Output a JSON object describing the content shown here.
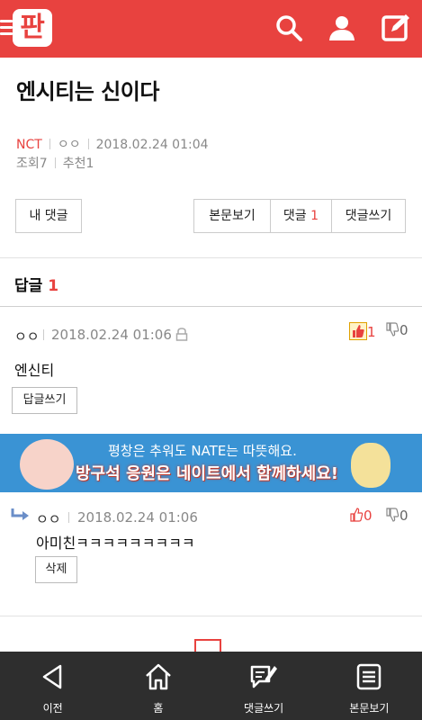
{
  "header": {
    "logo_text": "판",
    "icons": [
      "menu-icon",
      "search-icon",
      "user-icon",
      "write-icon"
    ],
    "bg_color": "#e8423f"
  },
  "post": {
    "title": "엔시티는 신이다",
    "category": "NCT",
    "author": "ㅇㅇ",
    "date": "2018.02.24 01:04",
    "views_label": "조회",
    "views": "7",
    "recommend_label": "추천",
    "recommends": "1"
  },
  "buttons": {
    "my_comments": "내 댓글",
    "view_body": "본문보기",
    "comments_label": "댓글",
    "comments_count": "1",
    "write_comment": "댓글쓰기"
  },
  "replies": {
    "heading_label": "답글",
    "count": "1"
  },
  "comments": [
    {
      "author": "ㅇㅇ",
      "date": "2018.02.24 01:06",
      "text": "엔신티",
      "action": "답글쓰기",
      "likes": "1",
      "dislikes": "0"
    },
    {
      "author": "ㅇㅇ",
      "date": "2018.02.24 01:06",
      "text": "아미친ㅋㅋㅋㅋㅋㅋㅋㅋㅋ",
      "action": "삭제",
      "likes": "0",
      "dislikes": "0"
    }
  ],
  "banner": {
    "line1": "평창은 추워도 NATE는 따뜻해요.",
    "line2": "방구석 응원은 네이트에서 함께하세요!"
  },
  "bottom_nav": [
    {
      "label": "이전",
      "icon": "back-icon"
    },
    {
      "label": "홈",
      "icon": "home-icon"
    },
    {
      "label": "댓글쓰기",
      "icon": "comment-write-icon"
    },
    {
      "label": "본문보기",
      "icon": "document-icon"
    }
  ]
}
